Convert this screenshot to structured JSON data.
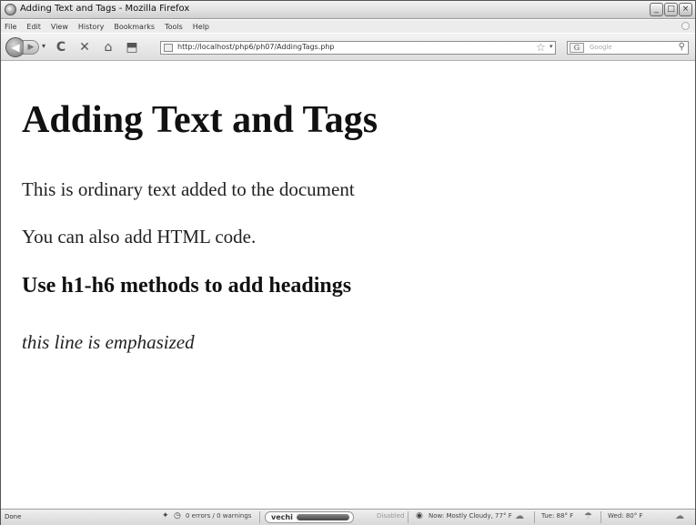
{
  "window": {
    "title": "Adding Text and Tags - Mozilla Firefox",
    "buttons": {
      "minimize": "_",
      "maximize": "□",
      "close": "×"
    }
  },
  "menubar": {
    "items": [
      {
        "label": "File"
      },
      {
        "label": "Edit"
      },
      {
        "label": "View"
      },
      {
        "label": "History"
      },
      {
        "label": "Bookmarks"
      },
      {
        "label": "Tools"
      },
      {
        "label": "Help"
      }
    ]
  },
  "navbar": {
    "back_icon": "◀",
    "forward_icon": "▶",
    "dropdown_icon": "▾",
    "reload_icon": "C",
    "stop_icon": "✕",
    "home_icon": "⌂",
    "bookmark_icon": "⬒",
    "url": "http://localhost/php6/ph07/AddingTags.php",
    "star_icon": "☆",
    "url_dropdown_icon": "▾",
    "search_engine_label": "G",
    "search_placeholder": "Google",
    "search_icon": "⚲"
  },
  "content": {
    "h1": "Adding Text and Tags",
    "p1": "This is ordinary text added to the document",
    "p2": "You can also add HTML code.",
    "h3": "Use h1-h6 methods to add headings",
    "em": "this line is emphasized"
  },
  "statusbar": {
    "status": "Done",
    "errors": "0 errors / 0 warnings",
    "vechi_label": "vechi",
    "disabled": "Disabled",
    "weather_now": "Now: Mostly Cloudy, 77° F",
    "weather_tue": "Tue: 88° F",
    "weather_wed": "Wed: 80° F"
  }
}
